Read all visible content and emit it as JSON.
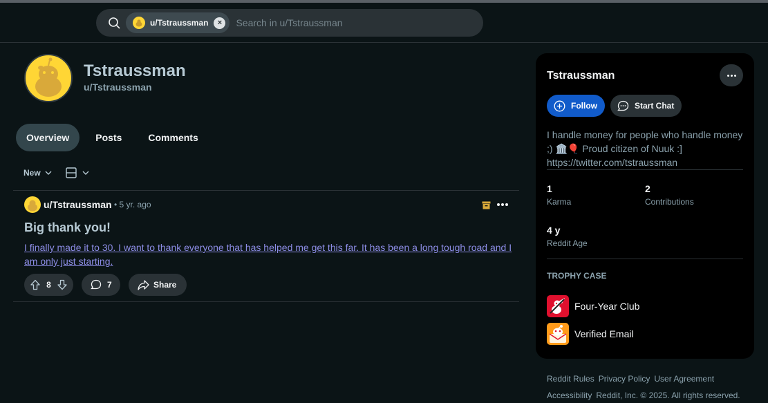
{
  "search": {
    "chip_label": "u/Tstraussman",
    "placeholder": "Search in u/Tstraussman"
  },
  "profile": {
    "display_name": "Tstraussman",
    "username": "u/Tstraussman"
  },
  "tabs": [
    {
      "label": "Overview",
      "active": true
    },
    {
      "label": "Posts",
      "active": false
    },
    {
      "label": "Comments",
      "active": false
    }
  ],
  "sort": {
    "label": "New"
  },
  "post": {
    "author": "u/Tstraussman",
    "time": "• 5 yr. ago",
    "title": "Big thank you!",
    "body": "I finally made it to 30. I want to thank everyone that has helped me get this far. It has been a long tough road and I am only just starting.",
    "votes": "8",
    "comments": "7",
    "share_label": "Share"
  },
  "sidebar": {
    "name": "Tstraussman",
    "follow_label": "Follow",
    "chat_label": "Start Chat",
    "bio": "I handle money for people who handle money ;) 🏛️🎈 Proud citizen of Nuuk :] https://twitter.com/tstraussman",
    "stats": [
      {
        "value": "1",
        "label": "Karma"
      },
      {
        "value": "2",
        "label": "Contributions"
      },
      {
        "value": "4 y",
        "label": "Reddit Age"
      }
    ],
    "trophy_heading": "TROPHY CASE",
    "trophies": [
      {
        "name": "Four-Year Club",
        "icon": "four-year-club-icon"
      },
      {
        "name": "Verified Email",
        "icon": "verified-email-icon"
      }
    ]
  },
  "footer": {
    "links": [
      "Reddit Rules",
      "Privacy Policy",
      "User Agreement",
      "Accessibility"
    ],
    "copyright": "Reddit, Inc. © 2025. All rights reserved."
  },
  "colors": {
    "background": "#0b1416",
    "accent_blue": "#115bca",
    "avatar_yellow": "#ffd635",
    "link_purple": "#8d8de6"
  }
}
